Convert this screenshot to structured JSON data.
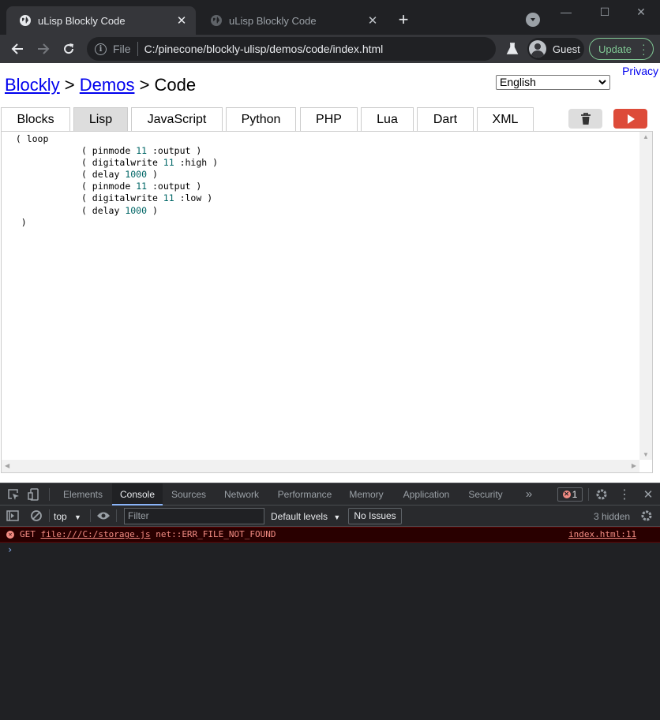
{
  "browser": {
    "tabs": [
      {
        "title": "uLisp Blockly Code",
        "active": true
      },
      {
        "title": "uLisp Blockly Code",
        "active": false
      }
    ],
    "new_tab": "+",
    "window_controls": {
      "minimize": "—",
      "maximize": "☐",
      "close": "✕"
    },
    "omnibox": {
      "scheme": "File",
      "url": "C:/pinecone/blockly-ulisp/demos/code/index.html"
    },
    "profile_name": "Guest",
    "update_label": "Update"
  },
  "page": {
    "privacy": "Privacy",
    "language": "English",
    "breadcrumb": {
      "link1": "Blockly",
      "sep1": " > ",
      "link2": "Demos",
      "sep2": " > ",
      "current": "Code"
    },
    "tabs": [
      "Blocks",
      "Lisp",
      "JavaScript",
      "Python",
      "PHP",
      "Lua",
      "Dart",
      "XML"
    ],
    "selected_tab": "Lisp",
    "code": {
      "l1": "( loop",
      "l2a": "( pinmode ",
      "l2n": "11",
      "l2b": " :output )",
      "l3a": "( digitalwrite ",
      "l3n": "11",
      "l3b": " :high )",
      "l4a": "( delay ",
      "l4n": "1000",
      "l4b": " )",
      "l5a": "( pinmode ",
      "l5n": "11",
      "l5b": " :output )",
      "l6a": "( digitalwrite ",
      "l6n": "11",
      "l6b": " :low )",
      "l7a": "( delay ",
      "l7n": "1000",
      "l7b": " )",
      "l8": ")"
    }
  },
  "devtools": {
    "tabs": [
      "Elements",
      "Console",
      "Sources",
      "Network",
      "Performance",
      "Memory",
      "Application",
      "Security"
    ],
    "selected_tab": "Console",
    "more": "»",
    "error_count": "1",
    "context": "top",
    "filter_placeholder": "Filter",
    "levels": "Default levels",
    "issues": "No Issues",
    "hidden": "3 hidden",
    "error": {
      "method": "GET ",
      "file": "file:///C:/storage.js",
      "code": " net::ERR_FILE_NOT_FOUND",
      "source": "index.html:11"
    },
    "prompt": "›"
  }
}
